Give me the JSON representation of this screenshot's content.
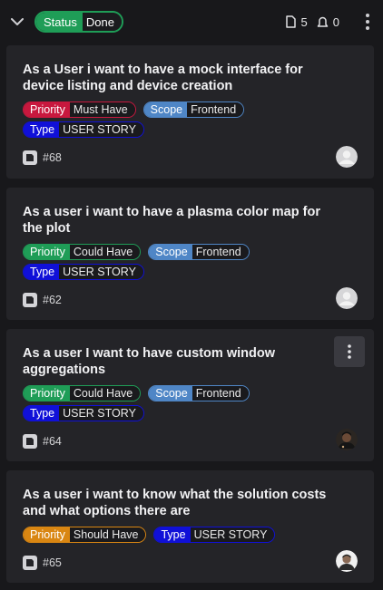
{
  "header": {
    "status_key": "Status",
    "status_value": "Done",
    "docs_count": "5",
    "alerts_count": "0"
  },
  "colors": {
    "status_green": "#1f9d57",
    "priority_must": "#c8183e",
    "priority_could": "#1f9d57",
    "priority_should": "#d98612",
    "scope": "#4f86c6",
    "type": "#1010d8"
  },
  "cards": [
    {
      "title": "As a User i want to have a mock interface for device listing and device creation",
      "tags": [
        {
          "key": "Priority",
          "value": "Must Have",
          "color": "#c8183e"
        },
        {
          "key": "Scope",
          "value": "Frontend",
          "color": "#4f86c6"
        },
        {
          "key": "Type",
          "value": "USER STORY",
          "color": "#1010d8"
        }
      ],
      "number": "#68",
      "avatar": "default-avatar-icon"
    },
    {
      "title": "As a user i want to have a plasma color map for the plot",
      "tags": [
        {
          "key": "Priority",
          "value": "Could Have",
          "color": "#1f9d57"
        },
        {
          "key": "Scope",
          "value": "Frontend",
          "color": "#4f86c6"
        },
        {
          "key": "Type",
          "value": "USER STORY",
          "color": "#1010d8"
        }
      ],
      "number": "#62",
      "avatar": "default-avatar-icon"
    },
    {
      "title": "As a user I want to have custom window aggregations",
      "tags": [
        {
          "key": "Priority",
          "value": "Could Have",
          "color": "#1f9d57"
        },
        {
          "key": "Scope",
          "value": "Frontend",
          "color": "#4f86c6"
        },
        {
          "key": "Type",
          "value": "USER STORY",
          "color": "#1010d8"
        }
      ],
      "number": "#64",
      "avatar": "user-photo-avatar",
      "menu_visible": true
    },
    {
      "title": "As a user i want to know what the solution costs and what options there are",
      "tags": [
        {
          "key": "Priority",
          "value": "Should Have",
          "color": "#d98612"
        },
        {
          "key": "Type",
          "value": "USER STORY",
          "color": "#1010d8"
        }
      ],
      "number": "#65",
      "avatar": "user-photo-avatar"
    }
  ]
}
